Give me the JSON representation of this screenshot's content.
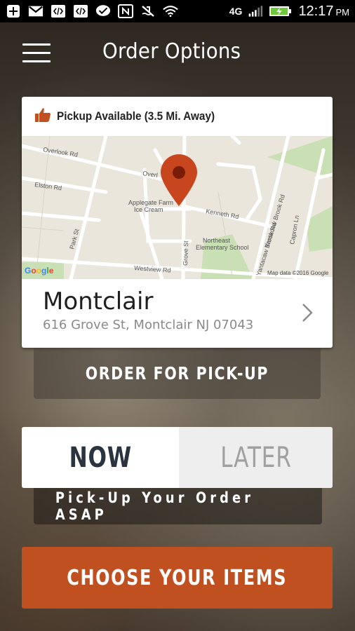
{
  "status_bar": {
    "time": "12:17",
    "ampm": "PM",
    "icons": [
      "add-icon",
      "gmail-icon",
      "code-icon",
      "code-icon",
      "chat-icon",
      "nfc-icon",
      "vibrate-icon",
      "wifi-icon",
      "4g-lte-icon",
      "signal-icon",
      "battery-charging-icon"
    ],
    "network": "4G"
  },
  "header": {
    "title": "Order Options",
    "menu_icon": "hamburger-menu-icon"
  },
  "location_card": {
    "availability": "Pickup Available (3.5 Mi. Away)",
    "availability_icon": "thumbs-up-icon",
    "map": {
      "street_labels": [
        "Overlook Rd",
        "Overl",
        "Elston Rd",
        "Park St",
        "Grove St",
        "Westview Rd",
        "Kenneth Rd",
        "Yantacaw Brook Rd",
        "Yantacaw Brook Rd",
        "Capron Ln"
      ],
      "place_labels": [
        "Applegate Farm",
        "Ice Cream",
        "Northeast",
        "Elementary School"
      ],
      "attribution": "Map data ©2016 Google",
      "logo": "Google",
      "pin_color": "#c7461e"
    },
    "name": "Montclair",
    "address": "616 Grove St, Montclair NJ 07043"
  },
  "order_type_tab": "ORDER FOR PICK-UP",
  "timing": {
    "now": "NOW",
    "later": "LATER",
    "selected": "NOW"
  },
  "timing_caption": "Pick-Up Your Order ASAP",
  "cta": "CHOOSE YOUR ITEMS",
  "colors": {
    "accent": "#c0501f",
    "pin": "#c7461e",
    "thumb": "#c0501f",
    "now_text": "#2a3440",
    "later_text": "#a0a0a0"
  }
}
